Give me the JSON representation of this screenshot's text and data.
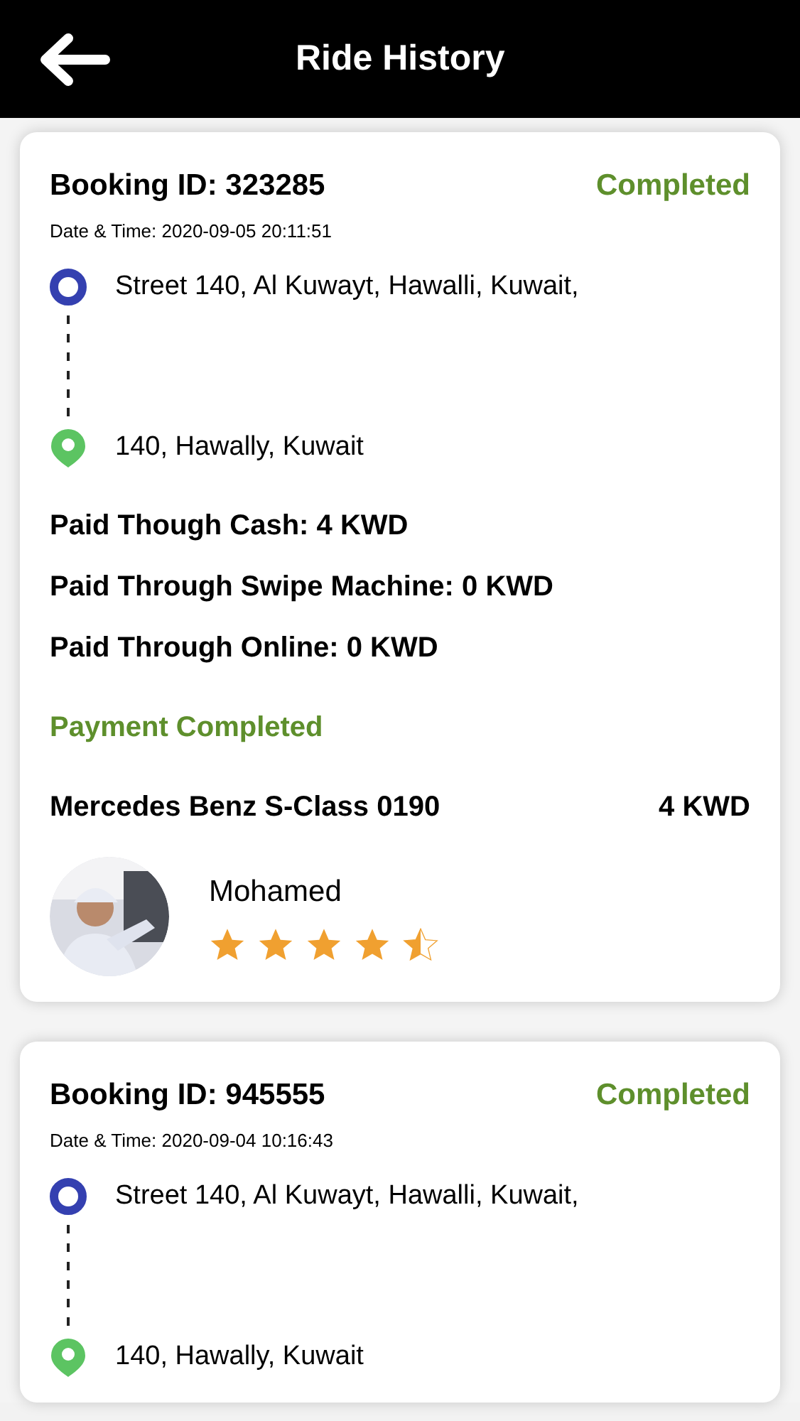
{
  "header": {
    "title": "Ride History"
  },
  "rides": [
    {
      "booking_id": "Booking ID: 323285",
      "status": "Completed",
      "date_time": "Date & Time: 2020-09-05 20:11:51",
      "pickup": "Street 140, Al Kuwayt, Hawalli, Kuwait,",
      "dropoff": "140, Hawally, Kuwait",
      "payments": [
        "Paid Though Cash: 4 KWD",
        "Paid Through Swipe Machine: 0 KWD",
        "Paid Through Online: 0 KWD"
      ],
      "payment_status": "Payment Completed",
      "vehicle": "Mercedes Benz S-Class 0190",
      "fare": "4 KWD",
      "driver": {
        "name": "Mohamed",
        "stars": 4.5
      }
    },
    {
      "booking_id": "Booking ID: 945555",
      "status": "Completed",
      "date_time": "Date & Time: 2020-09-04 10:16:43",
      "pickup": "Street 140, Al Kuwayt, Hawalli, Kuwait,",
      "dropoff": "140, Hawally, Kuwait"
    }
  ]
}
